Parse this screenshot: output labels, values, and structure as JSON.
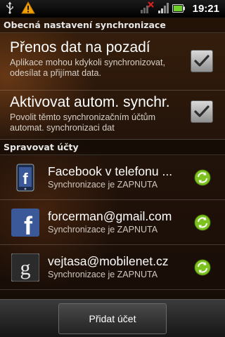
{
  "status_bar": {
    "time": "19:21",
    "icons": [
      "usb-icon",
      "warning-icon",
      "signal-off-icon",
      "signal-bars-icon",
      "battery-icon"
    ]
  },
  "sync_settings": {
    "header": "Obecná nastavení synchronizace",
    "background_data": {
      "title": "Přenos dat na pozadí",
      "description": "Aplikace mohou kdykoli synchronizovat, odesílat a přijímat data.",
      "checked": true
    },
    "auto_sync": {
      "title": "Aktivovat autom. synchr.",
      "description": "Povolit těmto synchronizačním účtům automat. synchronizaci dat",
      "checked": true
    }
  },
  "accounts": {
    "header": "Spravovat účty",
    "items": [
      {
        "name": "Facebook v telefonu ...",
        "status": "Synchronizace je ZAPNUTA",
        "icon": "facebook-phone-icon"
      },
      {
        "name": "forcerman@gmail.com",
        "status": "Synchronizace je ZAPNUTA",
        "icon": "facebook-icon"
      },
      {
        "name": "vejtasa@mobilenet.cz",
        "status": "Synchronizace je ZAPNUTA",
        "icon": "google-icon"
      }
    ]
  },
  "footer": {
    "add_account_label": "Přidat účet"
  },
  "colors": {
    "sync_green": "#7dc21e",
    "facebook_blue": "#3b5998"
  }
}
